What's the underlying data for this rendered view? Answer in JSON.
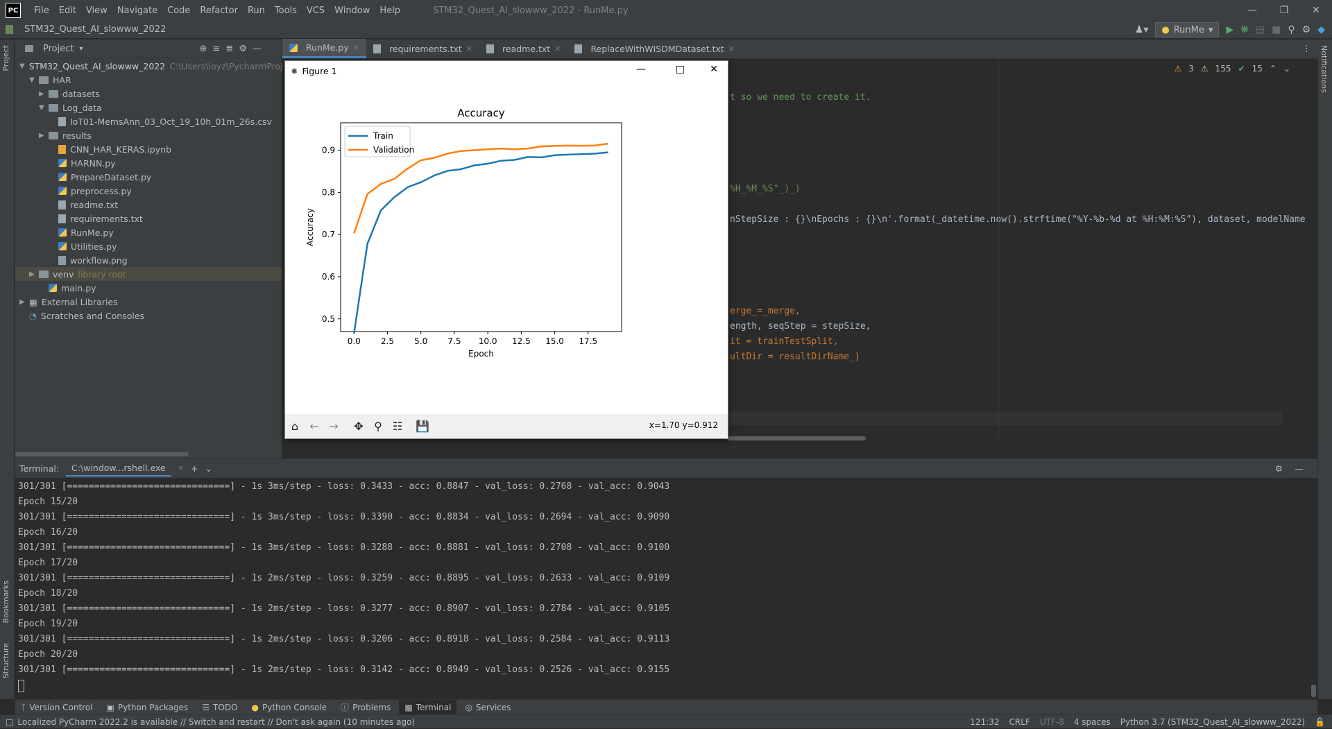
{
  "window": {
    "logo": "PC",
    "title": "STM32_Quest_AI_slowww_2022 - RunMe.py",
    "menu": [
      "File",
      "Edit",
      "View",
      "Navigate",
      "Code",
      "Refactor",
      "Run",
      "Tools",
      "VCS",
      "Window",
      "Help"
    ]
  },
  "navbar": {
    "breadcrumb": "STM32_Quest_AI_slowww_2022",
    "run_config": "RunMe"
  },
  "side_labels": {
    "project": "Project",
    "bookmarks": "Bookmarks",
    "structure": "Structure",
    "notifications": "Notifications"
  },
  "project": {
    "header": "Project",
    "tree": [
      {
        "label": "STM32_Quest_AI_slowww_2022",
        "hint": "C:\\Users\\loyz\\PycharmProj"
      },
      {
        "label": "HAR"
      },
      {
        "label": "datasets"
      },
      {
        "label": "Log_data"
      },
      {
        "label": "IoT01-MemsAnn_03_Oct_19_10h_01m_26s.csv"
      },
      {
        "label": "results"
      },
      {
        "label": "CNN_HAR_KERAS.ipynb"
      },
      {
        "label": "HARNN.py"
      },
      {
        "label": "PrepareDataset.py"
      },
      {
        "label": "preprocess.py"
      },
      {
        "label": "readme.txt"
      },
      {
        "label": "requirements.txt"
      },
      {
        "label": "RunMe.py"
      },
      {
        "label": "Utilities.py"
      },
      {
        "label": "workflow.png"
      },
      {
        "label": "venv",
        "hint": "library root"
      },
      {
        "label": "main.py"
      },
      {
        "label": "External Libraries"
      },
      {
        "label": "Scratches and Consoles"
      }
    ]
  },
  "tabs": [
    "RunMe.py",
    "requirements.txt",
    "readme.txt",
    "ReplaceWithWISDMDataset.txt"
  ],
  "inspections": {
    "errors": "3",
    "warnings": "155",
    "ok": "15"
  },
  "code": [
    "t so we need to create it.",
    "%H_%M_%S\"_)_)",
    "nStepSize : {}\\nEpochs : {}\\n'.format(_datetime.now().strftime(\"%Y-%b-%d at %H:%M:%S\"), dataset, modelName",
    "erge_=_merge,",
    "ength, seqStep = stepSize,",
    "it = trainTestSplit,",
    "ultDir = resultDirName_)"
  ],
  "figure": {
    "window_title": "Figure 1",
    "coords": "x=1.70 y=0.912"
  },
  "chart_data": {
    "type": "line",
    "title": "Accuracy",
    "xlabel": "Epoch",
    "ylabel": "Accuracy",
    "xlim": [
      -1,
      20
    ],
    "ylim": [
      0.47,
      0.965
    ],
    "xticks": [
      "0.0",
      "2.5",
      "5.0",
      "7.5",
      "10.0",
      "12.5",
      "15.0",
      "17.5"
    ],
    "yticks": [
      "0.5",
      "0.6",
      "0.7",
      "0.8",
      "0.9"
    ],
    "legend": "upper-left",
    "x": [
      0,
      1,
      2,
      3,
      4,
      5,
      6,
      7,
      8,
      9,
      10,
      11,
      12,
      13,
      14,
      15,
      16,
      17,
      18,
      19
    ],
    "series": [
      {
        "name": "Train",
        "color": "#1f77b4",
        "values": [
          0.466,
          0.678,
          0.757,
          0.788,
          0.812,
          0.824,
          0.84,
          0.851,
          0.855,
          0.864,
          0.868,
          0.875,
          0.877,
          0.884,
          0.883,
          0.8881,
          0.8895,
          0.8907,
          0.8918,
          0.8949
        ]
      },
      {
        "name": "Validation",
        "color": "#ff7f0e",
        "values": [
          0.703,
          0.796,
          0.82,
          0.832,
          0.856,
          0.876,
          0.882,
          0.892,
          0.898,
          0.9,
          0.902,
          0.904,
          0.902,
          0.904,
          0.909,
          0.91,
          0.9109,
          0.9105,
          0.9113,
          0.9155
        ]
      }
    ]
  },
  "terminal": {
    "label": "Terminal:",
    "tab": "C:\\window...rshell.exe",
    "lines": [
      "301/301 [==============================] - 1s 3ms/step - loss: 0.3433 - acc: 0.8847 - val_loss: 0.2768 - val_acc: 0.9043",
      "Epoch 15/20",
      "301/301 [==============================] - 1s 3ms/step - loss: 0.3390 - acc: 0.8834 - val_loss: 0.2694 - val_acc: 0.9090",
      "Epoch 16/20",
      "301/301 [==============================] - 1s 3ms/step - loss: 0.3288 - acc: 0.8881 - val_loss: 0.2708 - val_acc: 0.9100",
      "Epoch 17/20",
      "301/301 [==============================] - 1s 2ms/step - loss: 0.3259 - acc: 0.8895 - val_loss: 0.2633 - val_acc: 0.9109",
      "Epoch 18/20",
      "301/301 [==============================] - 1s 2ms/step - loss: 0.3277 - acc: 0.8907 - val_loss: 0.2784 - val_acc: 0.9105",
      "Epoch 19/20",
      "301/301 [==============================] - 1s 2ms/step - loss: 0.3206 - acc: 0.8918 - val_loss: 0.2584 - val_acc: 0.9113",
      "Epoch 20/20",
      "301/301 [==============================] - 1s 2ms/step - loss: 0.3142 - acc: 0.8949 - val_loss: 0.2526 - val_acc: 0.9155"
    ]
  },
  "bottom_tabs": [
    "Version Control",
    "Python Packages",
    "TODO",
    "Python Console",
    "Problems",
    "Terminal",
    "Services"
  ],
  "status": {
    "message": "Localized PyCharm 2022.2 is available // Switch and restart // Don't ask again (10 minutes ago)",
    "position": "121:32",
    "line_sep": "CRLF",
    "encoding": "UTF-8",
    "indent": "4 spaces",
    "interpreter": "Python 3.7 (STM32_Quest_AI_slowww_2022)"
  }
}
